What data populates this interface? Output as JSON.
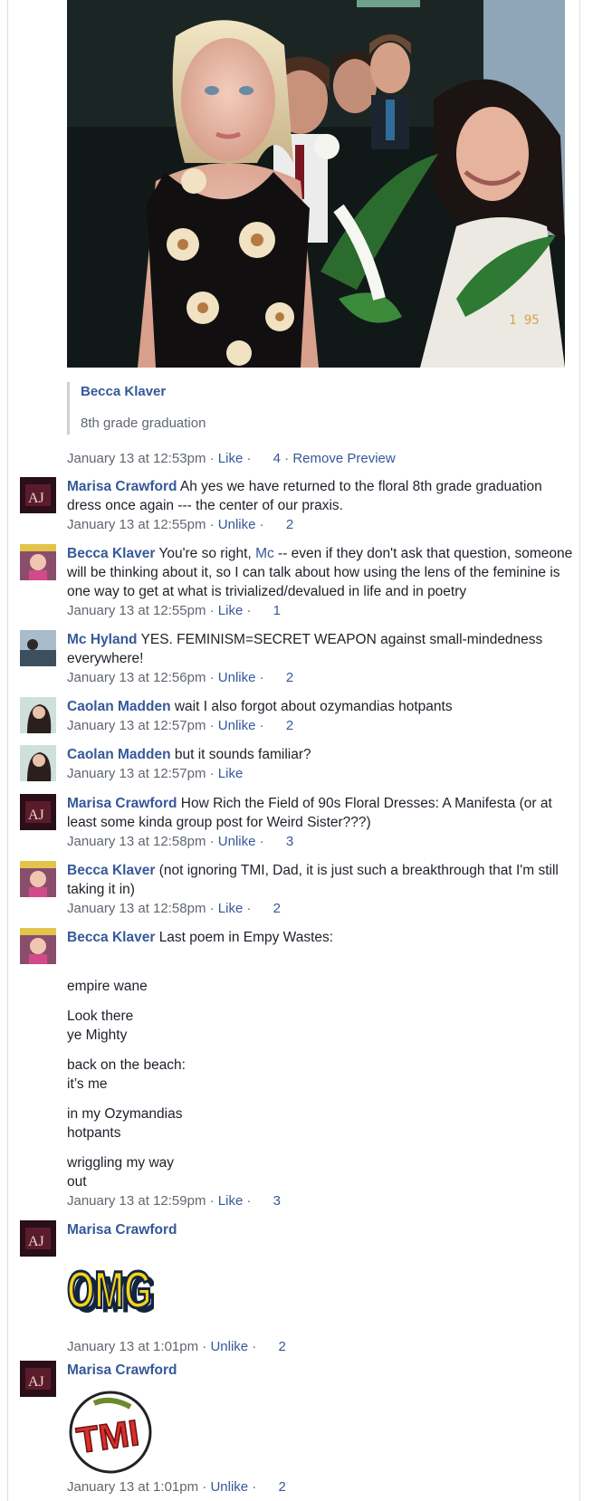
{
  "post": {
    "preview_author": "Becca Klaver",
    "preview_text": "8th grade graduation",
    "timestamp": "January 13 at 12:53pm",
    "like_label": "Like",
    "like_count": "4",
    "remove_preview_label": "Remove Preview"
  },
  "comments": [
    {
      "author": "Marisa Crawford",
      "text": "Ah yes we have returned to the floral 8th grade graduation dress once again --- the center of our praxis.",
      "timestamp": "January 13 at 12:55pm",
      "action": "Unlike",
      "count": "2"
    },
    {
      "author": "Becca Klaver",
      "text_before": "You're so right, ",
      "mention": "Mc",
      "text_after": " -- even if they don't ask that question, someone will be thinking about it, so I can talk about how using the lens of the feminine is one way to get at what is trivialized/devalued in life and in poetry",
      "timestamp": "January 13 at 12:55pm",
      "action": "Like",
      "count": "1"
    },
    {
      "author": "Mc Hyland",
      "text": "YES. FEMINISM=SECRET WEAPON against small-mindedness everywhere!",
      "timestamp": "January 13 at 12:56pm",
      "action": "Unlike",
      "count": "2"
    },
    {
      "author": "Caolan Madden",
      "text": "wait I also forgot about ozymandias hotpants",
      "timestamp": "January 13 at 12:57pm",
      "action": "Unlike",
      "count": "2"
    },
    {
      "author": "Caolan Madden",
      "text": "but it sounds familiar?",
      "timestamp": "January 13 at 12:57pm",
      "action": "Like",
      "count": ""
    },
    {
      "author": "Marisa Crawford",
      "text": "How Rich the Field of 90s Floral Dresses: A Manifesta (or at least some kinda group post for Weird Sister???)",
      "timestamp": "January 13 at 12:58pm",
      "action": "Unlike",
      "count": "3"
    },
    {
      "author": "Becca Klaver",
      "text": "(not ignoring TMI, Dad, it is just such a breakthrough that I'm still taking it in)",
      "timestamp": "January 13 at 12:58pm",
      "action": "Like",
      "count": "2"
    },
    {
      "author": "Becca Klaver",
      "text": "Last poem in Empy Wastes:",
      "poem": [
        "empire wane",
        "Look there",
        "ye Mighty",
        "back on the beach:",
        "it’s me",
        "in my Ozymandias",
        "hotpants",
        "wriggling my way",
        "out"
      ],
      "timestamp": "January 13 at 12:59pm",
      "action": "Like",
      "count": "3"
    },
    {
      "author": "Marisa Crawford",
      "sticker": "OMG",
      "timestamp": "January 13 at 1:01pm",
      "action": "Unlike",
      "count": "2"
    },
    {
      "author": "Marisa Crawford",
      "sticker": "TMI",
      "timestamp": "January 13 at 1:01pm",
      "action": "Unlike",
      "count": "2"
    }
  ],
  "colors": {
    "link": "#365899",
    "meta": "#606770",
    "text": "#1d2129"
  }
}
